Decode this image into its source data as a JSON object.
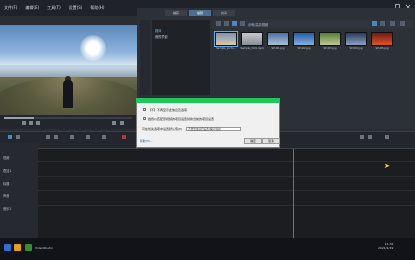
{
  "menu": {
    "items": [
      "文件(F)",
      "编辑(E)",
      "工具(T)",
      "设置(S)",
      "帮助(H)"
    ]
  },
  "library": {
    "tabs": [
      "捕获",
      "编辑",
      "共享"
    ],
    "active_tab": 1,
    "tree": [
      "媒体",
      "我的项目"
    ],
    "path": "示例/高清视频",
    "thumbnails": [
      {
        "caption": "Sample_pictu...",
        "colors": [
          "#7d93b8",
          "#d8c9a6"
        ]
      },
      {
        "caption": "Sample_Vid1.mp4",
        "colors": [
          "#c7c8cc",
          "#8a8d96"
        ]
      },
      {
        "caption": "SP-I01.jpg",
        "colors": [
          "#4e6f9c",
          "#a9c0d8"
        ]
      },
      {
        "caption": "SP-I02.jpg",
        "colors": [
          "#2a5c9e",
          "#7fb1e2"
        ]
      },
      {
        "caption": "SP-I03.jpg",
        "colors": [
          "#5a7d3c",
          "#b9c98a"
        ]
      },
      {
        "caption": "SP-I04.jpg",
        "colors": [
          "#2b3a55",
          "#8aa2c6"
        ]
      },
      {
        "caption": "SP-I05.jpg",
        "colors": [
          "#6b1c16",
          "#e0532a"
        ]
      }
    ]
  },
  "dialog": {
    "line1": "【不】不再显示此信息及选项",
    "line2": "始终以匹配原视频的项目设置替换当前的项目设置",
    "line3": "可在优先选项中设置默认值(P)",
    "select_value": "不要更改项目设置(保持当前)",
    "link": "帮助(H)...",
    "ok": "确定",
    "cancel": "取消"
  },
  "timeline": {
    "tracks": [
      "视频",
      "叠加1",
      "标题",
      "声音",
      "音乐1"
    ]
  },
  "taskbar": {
    "app_label": "VideoStudio",
    "time": "11:32",
    "date": "2021/1/19"
  }
}
